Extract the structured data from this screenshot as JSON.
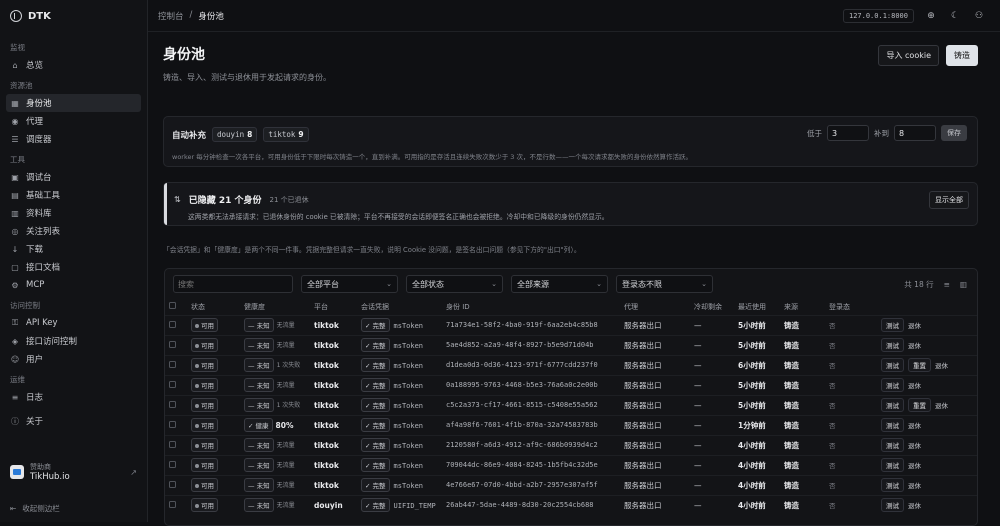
{
  "brand": "DTK",
  "nav": {
    "sections": [
      {
        "title": "监视",
        "items": [
          {
            "label": "总览",
            "icon": "home-icon",
            "glyph": "⌂"
          }
        ]
      },
      {
        "title": "资源池",
        "items": [
          {
            "label": "身份池",
            "icon": "id-icon",
            "glyph": "▦",
            "active": true
          },
          {
            "label": "代理",
            "icon": "proxy-icon",
            "glyph": "◉"
          },
          {
            "label": "调度器",
            "icon": "scheduler-icon",
            "glyph": "☰"
          }
        ]
      },
      {
        "title": "工具",
        "items": [
          {
            "label": "调试台",
            "icon": "console-icon",
            "glyph": "▣"
          },
          {
            "label": "基础工具",
            "icon": "tools-icon",
            "glyph": "▤"
          },
          {
            "label": "资料库",
            "icon": "library-icon",
            "glyph": "▥"
          },
          {
            "label": "关注列表",
            "icon": "watch-icon",
            "glyph": "◎"
          },
          {
            "label": "下载",
            "icon": "download-icon",
            "glyph": "↓"
          },
          {
            "label": "接口文档",
            "icon": "docs-icon",
            "glyph": "▢"
          },
          {
            "label": "MCP",
            "icon": "mcp-icon",
            "glyph": "⚙"
          }
        ]
      },
      {
        "title": "访问控制",
        "items": [
          {
            "label": "API Key",
            "icon": "key-icon",
            "glyph": "⚿"
          },
          {
            "label": "接口访问控制",
            "icon": "shield-icon",
            "glyph": "◈"
          },
          {
            "label": "用户",
            "icon": "user-icon",
            "glyph": "☺"
          }
        ]
      },
      {
        "title": "运维",
        "items": [
          {
            "label": "日志",
            "icon": "log-icon",
            "glyph": "≡"
          }
        ]
      },
      {
        "title": "",
        "items": [
          {
            "label": "关于",
            "icon": "info-icon",
            "glyph": "ⓘ"
          }
        ]
      }
    ]
  },
  "sponsor": {
    "label": "赞助商",
    "name": "TikHub.io"
  },
  "collapse_label": "收起侧边栏",
  "breadcrumb": {
    "root": "控制台",
    "sep": "/",
    "current": "身份池"
  },
  "host": "127.0.0.1:8000",
  "page": {
    "title": "身份池",
    "subtitle": "铸造、导入、测试与退休用于发起请求的身份。",
    "import_label": "导入 cookie",
    "mint_label": "铸造"
  },
  "autofill": {
    "label": "自动补充",
    "platforms": [
      {
        "name": "douyin",
        "count": "8"
      },
      {
        "name": "tiktok",
        "count": "9"
      }
    ],
    "floor_label": "低于",
    "floor_value": "3",
    "refill_label": "补到",
    "refill_value": "8",
    "save_label": "保存",
    "desc": "worker 每分钟检查一次各平台，可用身份低于下限时每次铸造一个，直到补满。可用指的是存活且连续失败次数少于 3 次，不是行数——一个每次请求都失败的身份依然算作活跃。"
  },
  "hidden": {
    "title": "已隐藏 21 个身份",
    "sub": "21 个已退休",
    "desc": "这两类都无法承接请求：已退休身份的 cookie 已被清除；平台不再接受的会话即便签名正确也会被拒绝。冷却中和已降级的身份仍然显示。",
    "show_all": "显示全部"
  },
  "note": "「会话凭据」和「健康度」是两个不同一件事。凭据完整但请求一直失败，说明 Cookie 没问题，是签名出口问题（参见下方的\"出口\"列）。",
  "filters": {
    "search_placeholder": "搜索",
    "platform": "全部平台",
    "status": "全部状态",
    "source": "全部来源",
    "login": "登录态不限",
    "total": "共 18 行"
  },
  "table": {
    "headers": [
      "",
      "状态",
      "健康度",
      "平台",
      "会话凭据",
      "身份 ID",
      "代理",
      "冷却剩余",
      "最近使用",
      "来源",
      "登录态",
      ""
    ],
    "rows": [
      {
        "status": "可用",
        "health": "未知",
        "health_note": "无流量",
        "platform": "tiktok",
        "cred": "完整",
        "cred_key": "msToken",
        "id": "71a734e1-58f2-4ba0-919f-6aa2eb4c85b8",
        "proxy": "服务器出口",
        "cool": "—",
        "last": "5小时前",
        "source": "铸造",
        "login": "否",
        "actions": [
          "测试",
          "退休"
        ]
      },
      {
        "status": "可用",
        "health": "未知",
        "health_note": "无流量",
        "platform": "tiktok",
        "cred": "完整",
        "cred_key": "msToken",
        "id": "5ae4d852-a2a9-48f4-8927-b5e9d71d04b",
        "proxy": "服务器出口",
        "cool": "—",
        "last": "5小时前",
        "source": "铸造",
        "login": "否",
        "actions": [
          "测试",
          "退休"
        ]
      },
      {
        "status": "可用",
        "health": "未知",
        "health_note": "1 次失败",
        "platform": "tiktok",
        "cred": "完整",
        "cred_key": "msToken",
        "id": "d1dea0d3-0d36-4123-971f-6777cdd237f0",
        "proxy": "服务器出口",
        "cool": "—",
        "last": "6小时前",
        "source": "铸造",
        "login": "否",
        "actions": [
          "测试",
          "重置",
          "退休"
        ]
      },
      {
        "status": "可用",
        "health": "未知",
        "health_note": "无流量",
        "platform": "tiktok",
        "cred": "完整",
        "cred_key": "msToken",
        "id": "0a188995-9763-4468-b5e3-76a6a0c2e00b",
        "proxy": "服务器出口",
        "cool": "—",
        "last": "5小时前",
        "source": "铸造",
        "login": "否",
        "actions": [
          "测试",
          "退休"
        ]
      },
      {
        "status": "可用",
        "health": "未知",
        "health_note": "1 次失败",
        "platform": "tiktok",
        "cred": "完整",
        "cred_key": "msToken",
        "id": "c5c2a373-cf17-4661-8515-c5408e55a562",
        "proxy": "服务器出口",
        "cool": "—",
        "last": "5小时前",
        "source": "铸造",
        "login": "否",
        "actions": [
          "测试",
          "重置",
          "退休"
        ]
      },
      {
        "status": "可用",
        "health": "健康",
        "health_note": "80%",
        "platform": "tiktok",
        "cred": "完整",
        "cred_key": "msToken",
        "id": "af4a98f6-7601-4f1b-870a-32a74583783b",
        "proxy": "服务器出口",
        "cool": "—",
        "last": "1分钟前",
        "source": "铸造",
        "login": "否",
        "actions": [
          "测试",
          "退休"
        ]
      },
      {
        "status": "可用",
        "health": "未知",
        "health_note": "无流量",
        "platform": "tiktok",
        "cred": "完整",
        "cred_key": "msToken",
        "id": "2120580f-a6d3-4912-af9c-686b0939d4c2",
        "proxy": "服务器出口",
        "cool": "—",
        "last": "4小时前",
        "source": "铸造",
        "login": "否",
        "actions": [
          "测试",
          "退休"
        ]
      },
      {
        "status": "可用",
        "health": "未知",
        "health_note": "无流量",
        "platform": "tiktok",
        "cred": "完整",
        "cred_key": "msToken",
        "id": "709044dc-86e9-4084-8245-1b5fb4c32d5e",
        "proxy": "服务器出口",
        "cool": "—",
        "last": "4小时前",
        "source": "铸造",
        "login": "否",
        "actions": [
          "测试",
          "退休"
        ]
      },
      {
        "status": "可用",
        "health": "未知",
        "health_note": "无流量",
        "platform": "tiktok",
        "cred": "完整",
        "cred_key": "msToken",
        "id": "4e766e67-07d0-4bbd-a2b7-2957e307af5f",
        "proxy": "服务器出口",
        "cool": "—",
        "last": "4小时前",
        "source": "铸造",
        "login": "否",
        "actions": [
          "测试",
          "退休"
        ]
      },
      {
        "status": "可用",
        "health": "未知",
        "health_note": "无流量",
        "platform": "douyin",
        "cred": "完整",
        "cred_key": "UIFID_TEMP",
        "id": "26ab447-5dae-4489-8d30-20c2554cb688",
        "proxy": "服务器出口",
        "cool": "—",
        "last": "4小时前",
        "source": "铸造",
        "login": "否",
        "actions": [
          "测试",
          "退休"
        ]
      }
    ]
  }
}
